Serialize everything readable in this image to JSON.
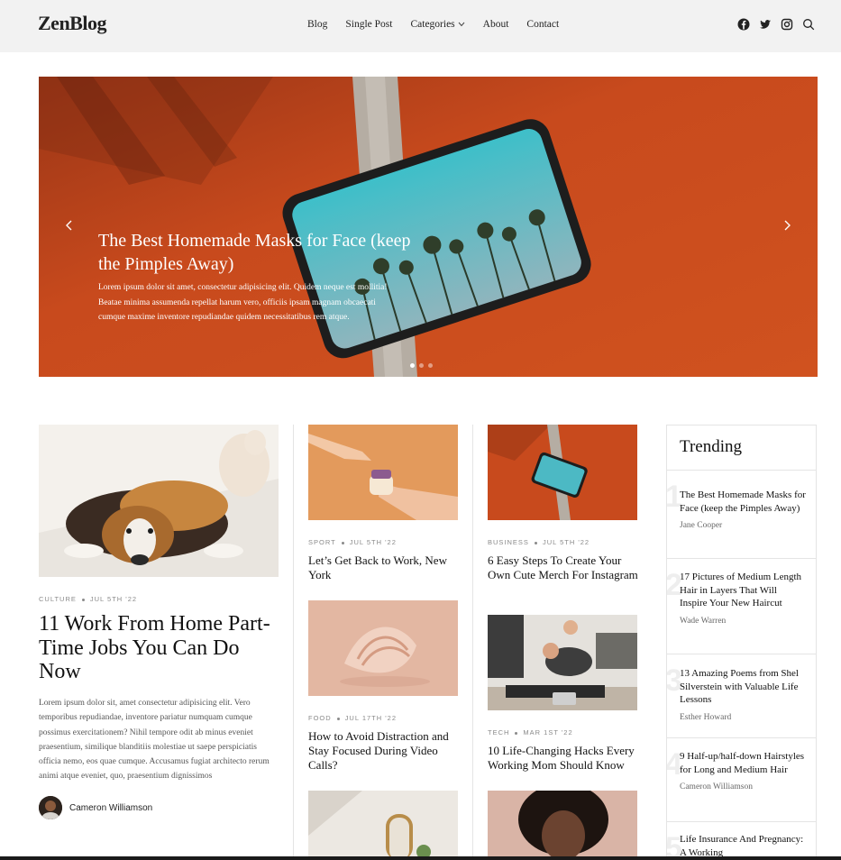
{
  "header": {
    "logo": "ZenBlog",
    "nav": [
      "Blog",
      "Single Post",
      "Categories",
      "About",
      "Contact"
    ],
    "social_icons": [
      "facebook-icon",
      "twitter-icon",
      "instagram-icon",
      "search-icon"
    ]
  },
  "hero": {
    "title": "The Best Homemade Masks for Face (keep the Pimples Away)",
    "excerpt": "Lorem ipsum dolor sit amet, consectetur adipisicing elit. Quidem neque est mollitia! Beatae minima assumenda repellat harum vero, officiis ipsam magnam obcaecati cumque maxime inventore repudiandae quidem necessitatibus rem atque.",
    "slide_count": 3,
    "active_slide": 1
  },
  "featured": {
    "category": "Culture",
    "date": "Jul 5th '22",
    "title": "11 Work From Home Part-Time Jobs You Can Do Now",
    "excerpt": "Lorem ipsum dolor sit, amet consectetur adipisicing elit. Vero temporibus repudiandae, inventore pariatur numquam cumque possimus exercitationem? Nihil tempore odit ab minus eveniet praesentium, similique blanditiis molestiae ut saepe perspiciatis officia nemo, eos quae cumque. Accusamus fugiat architecto rerum animi atque eveniet, quo, praesentium dignissimos",
    "author": "Cameron Williamson"
  },
  "column2": [
    {
      "category": "Sport",
      "date": "Jul 5th '22",
      "title": "Let’s Get Back to Work, New York"
    },
    {
      "category": "Food",
      "date": "Jul 17th '22",
      "title": "How to Avoid Distraction and Stay Focused During Video Calls?"
    }
  ],
  "column3": [
    {
      "category": "Business",
      "date": "Jul 5th '22",
      "title": "6 Easy Steps To Create Your Own Cute Merch For Instagram"
    },
    {
      "category": "Tech",
      "date": "Mar 1st '22",
      "title": "10 Life-Changing Hacks Every Working Mom Should Know"
    }
  ],
  "trending": {
    "heading": "Trending",
    "items": [
      {
        "num": "1",
        "title": "The Best Homemade Masks for Face (keep the Pimples Away)",
        "author": "Jane Cooper"
      },
      {
        "num": "2",
        "title": "17 Pictures of Medium Length Hair in Layers That Will Inspire Your New Haircut",
        "author": "Wade Warren"
      },
      {
        "num": "3",
        "title": "13 Amazing Poems from Shel Silverstein with Valuable Life Lessons",
        "author": "Esther Howard"
      },
      {
        "num": "4",
        "title": "9 Half-up/half-down Hairstyles for Long and Medium Hair",
        "author": "Cameron Williamson"
      },
      {
        "num": "5",
        "title": "Life Insurance And Pregnancy: A Working",
        "author": ""
      }
    ]
  },
  "colors": {
    "header_bg": "#f2f2f2",
    "hero_carpet": "#c4471c",
    "tablet_screen": "#5fb3c0",
    "text": "#111111",
    "meta": "#8a8a8a"
  }
}
